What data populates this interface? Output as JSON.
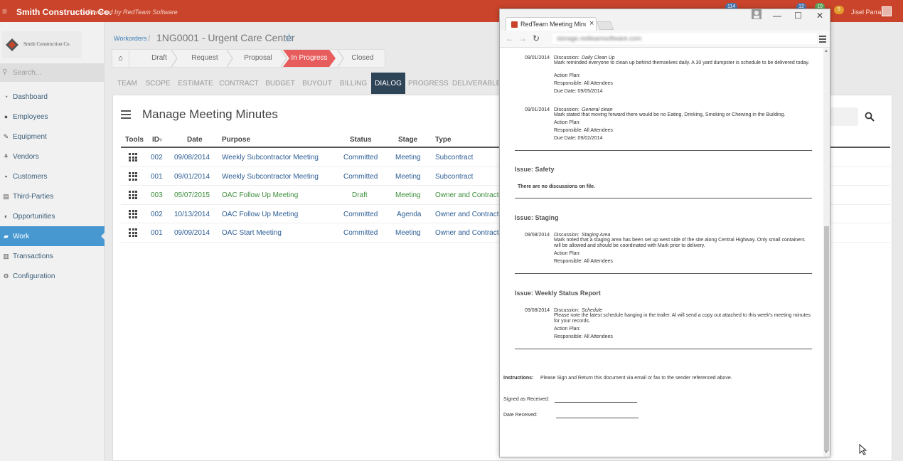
{
  "topbar": {
    "brand": "Smith Construction Co.",
    "powered_by": "Powered by RedTeam Software",
    "badges": [
      "114",
      "12",
      "10",
      "5"
    ],
    "user_name": "Jisel Parra"
  },
  "sidebar": {
    "logo_text": "Smith Construction Co.",
    "search_placeholder": "Search...",
    "items": [
      {
        "label": "Dashboard",
        "icon": "dashboard-icon"
      },
      {
        "label": "Employees",
        "icon": "employees-icon"
      },
      {
        "label": "Equipment",
        "icon": "wrench-icon"
      },
      {
        "label": "Vendors",
        "icon": "vendors-icon"
      },
      {
        "label": "Customers",
        "icon": "customers-icon"
      },
      {
        "label": "Third-Parties",
        "icon": "third-parties-icon"
      },
      {
        "label": "Opportunities",
        "icon": "opportunities-icon"
      },
      {
        "label": "Work",
        "icon": "work-icon",
        "active": true
      },
      {
        "label": "Transactions",
        "icon": "transactions-icon"
      },
      {
        "label": "Configuration",
        "icon": "gear-icon"
      }
    ]
  },
  "breadcrumb": {
    "parent": "Workorders",
    "separator": "/",
    "title": "1NG0001 - Urgent Care Center"
  },
  "steps": [
    "Draft",
    "Request",
    "Proposal",
    "In Progress",
    "Closed"
  ],
  "active_step": "In Progress",
  "tabs": [
    "TEAM",
    "SCOPE",
    "ESTIMATE",
    "CONTRACT",
    "BUDGET",
    "BUYOUT",
    "BILLING",
    "DIALOG",
    "PROGRESS",
    "DELIVERABLE"
  ],
  "active_tab": "DIALOG",
  "panel": {
    "title": "Manage Meeting Minutes",
    "columns": {
      "tools": "Tools",
      "id": "ID",
      "sort_glyph": "▿",
      "date": "Date",
      "purpose": "Purpose",
      "status": "Status",
      "stage": "Stage",
      "type": "Type"
    },
    "rows": [
      {
        "id": "002",
        "date": "09/08/2014",
        "purpose": "Weekly Subcontractor Meeting",
        "status": "Committed",
        "stage": "Meeting",
        "type": "Subcontract",
        "tone": "blue"
      },
      {
        "id": "001",
        "date": "09/01/2014",
        "purpose": "Weekly Subcontractor Meeting",
        "status": "Committed",
        "stage": "Meeting",
        "type": "Subcontract",
        "tone": "blue"
      },
      {
        "id": "003",
        "date": "05/07/2015",
        "purpose": "OAC Follow Up Meeting",
        "status": "Draft",
        "stage": "Meeting",
        "type": "Owner and Contractor",
        "tone": "green"
      },
      {
        "id": "002",
        "date": "10/13/2014",
        "purpose": "OAC Follow Up Meeting",
        "status": "Committed",
        "stage": "Agenda",
        "type": "Owner and Contractor",
        "tone": "blue"
      },
      {
        "id": "001",
        "date": "09/09/2014",
        "purpose": "OAC Start Meeting",
        "status": "Committed",
        "stage": "Meeting",
        "type": "Owner and Contractor",
        "tone": "blue"
      }
    ]
  },
  "popup": {
    "tab_title": "RedTeam Meeting Minute",
    "url": "storage.redteamsoftware.com",
    "discussions_top": [
      {
        "date": "09/01/2014",
        "label": "Discussion:",
        "topic": "Daily Clean Up",
        "text": "Mark reminded everyone to clean up behind themselves daily. A 30 yard dumpster is schedule to be delivered today.",
        "action": "Action Plan:",
        "responsible": "Responsible: All Attendees",
        "due": "Due Date: 09/05/2014"
      },
      {
        "date": "09/01/2014",
        "label": "Discussion:",
        "topic": "General clean",
        "text": "Mark stated that moving forward there would be no Eating, Drinking, Smoking or Chewing in the Building.",
        "action": "Action Plan:",
        "responsible": "Responsible: All Attendees",
        "due": "Due Date: 09/02/2014"
      }
    ],
    "issue_safety": "Issue: Safety",
    "no_discussions": "There are no discussions on file.",
    "issue_staging": "Issue: Staging",
    "staging": {
      "date": "09/08/2014",
      "label": "Discussion:",
      "topic": "Staging Area",
      "text": "Mark noted that a staging area has been set up west side of the site along Central Highway. Only small containers will be allowed and should be coordinated with Mark prior to delivery.",
      "action": "Action Plan:",
      "responsible": "Responsible: All Attendees"
    },
    "issue_weekly": "Issue: Weekly Status Report",
    "weekly": {
      "date": "09/08/2014",
      "label": "Discussion:",
      "topic": "Schedule",
      "text": "Please note the latest schedule hanging in the trailer. Al will send a copy out attached to this week's meeting minutes for your records.",
      "action": "Action Plan:",
      "responsible": "Responsible: All Attendees"
    },
    "instructions_label": "Instructions:",
    "instructions_text": "Please Sign and Return this document via email or fax to the sender referenced above.",
    "signed_label": "Signed as Received:",
    "date_label": "Date Received:"
  },
  "colors": {
    "topbar": "#c9442a",
    "active_nav": "#4797d1",
    "active_tab": "#2e4457",
    "in_progress": "#e75d5d",
    "link_blue": "#2c5d95",
    "draft_green": "#3c8f3c"
  }
}
